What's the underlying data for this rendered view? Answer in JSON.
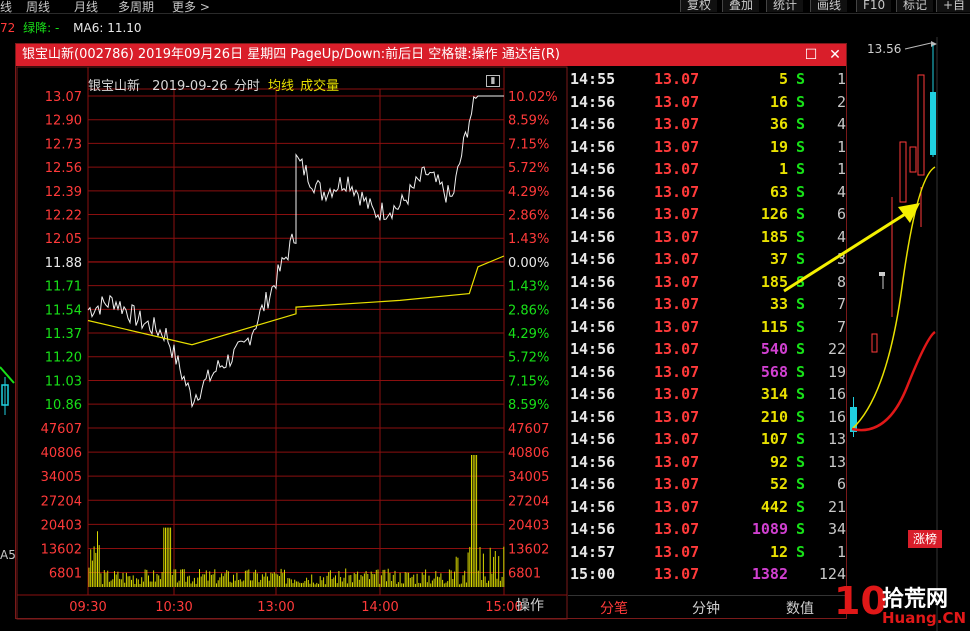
{
  "topbar": {
    "left_items": [
      "线",
      "周线",
      "月线",
      "多周期",
      "更多 >"
    ],
    "right_items": [
      "复权",
      "叠加",
      "统计",
      "画线",
      "F10",
      "标记",
      "+自"
    ]
  },
  "ma_row": {
    "prefix": "72",
    "label": "绿降: -",
    "ma6": "MA6: 11.10"
  },
  "popup": {
    "title": "银宝山新(002786) 2019年09月26日 星期四 PageUp/Down:前后日 空格键:操作 通达信(R)",
    "restore_icon": "restore-icon",
    "close_icon": "close-icon",
    "chart_header": {
      "name": "银宝山新",
      "date": "2019-09-26",
      "mode": "分时",
      "avg_label": "均线",
      "vol_label": "成交量"
    },
    "price_ticks": [
      "13.07",
      "12.90",
      "12.73",
      "12.56",
      "12.39",
      "12.22",
      "12.05",
      "11.88",
      "11.71",
      "11.54",
      "11.37",
      "11.20",
      "11.03",
      "10.86"
    ],
    "pct_ticks": [
      "10.02%",
      "8.59%",
      "7.15%",
      "5.72%",
      "4.29%",
      "2.86%",
      "1.43%",
      "0.00%",
      "1.43%",
      "2.86%",
      "4.29%",
      "5.72%",
      "7.15%",
      "8.59%"
    ],
    "vol_ticks": [
      "47607",
      "40806",
      "34005",
      "27204",
      "20403",
      "13602",
      "6801"
    ],
    "time_ticks": [
      "09:30",
      "10:30",
      "13:00",
      "14:00",
      "15:00"
    ],
    "operate_label": "操作",
    "tabs": [
      "分笔",
      "分钟",
      "数值"
    ],
    "colors": {
      "up": "#ff3a3a",
      "down": "#18e018",
      "neutral": "#e8e8e8",
      "grid": "#8a0f0f",
      "avg": "#e8e000",
      "volume": "#d8d800",
      "big_vol": "#e040e0"
    }
  },
  "trades": [
    {
      "time": "14:55",
      "price": "13.07",
      "vol": "5",
      "side": "S",
      "cnt": "1",
      "vc": "#e8e000"
    },
    {
      "time": "14:56",
      "price": "13.07",
      "vol": "16",
      "side": "S",
      "cnt": "2",
      "vc": "#e8e000"
    },
    {
      "time": "14:56",
      "price": "13.07",
      "vol": "36",
      "side": "S",
      "cnt": "4",
      "vc": "#e8e000"
    },
    {
      "time": "14:56",
      "price": "13.07",
      "vol": "19",
      "side": "S",
      "cnt": "1",
      "vc": "#e8e000"
    },
    {
      "time": "14:56",
      "price": "13.07",
      "vol": "1",
      "side": "S",
      "cnt": "1",
      "vc": "#e8e000"
    },
    {
      "time": "14:56",
      "price": "13.07",
      "vol": "63",
      "side": "S",
      "cnt": "4",
      "vc": "#e8e000"
    },
    {
      "time": "14:56",
      "price": "13.07",
      "vol": "126",
      "side": "S",
      "cnt": "6",
      "vc": "#e8e000"
    },
    {
      "time": "14:56",
      "price": "13.07",
      "vol": "185",
      "side": "S",
      "cnt": "4",
      "vc": "#e8e000"
    },
    {
      "time": "14:56",
      "price": "13.07",
      "vol": "37",
      "side": "S",
      "cnt": "3",
      "vc": "#e8e000"
    },
    {
      "time": "14:56",
      "price": "13.07",
      "vol": "185",
      "side": "S",
      "cnt": "8",
      "vc": "#e8e000"
    },
    {
      "time": "14:56",
      "price": "13.07",
      "vol": "33",
      "side": "S",
      "cnt": "7",
      "vc": "#e8e000"
    },
    {
      "time": "14:56",
      "price": "13.07",
      "vol": "115",
      "side": "S",
      "cnt": "7",
      "vc": "#e8e000"
    },
    {
      "time": "14:56",
      "price": "13.07",
      "vol": "540",
      "side": "S",
      "cnt": "22",
      "vc": "#d040d0"
    },
    {
      "time": "14:56",
      "price": "13.07",
      "vol": "568",
      "side": "S",
      "cnt": "19",
      "vc": "#d040d0"
    },
    {
      "time": "14:56",
      "price": "13.07",
      "vol": "314",
      "side": "S",
      "cnt": "16",
      "vc": "#e8e000"
    },
    {
      "time": "14:56",
      "price": "13.07",
      "vol": "210",
      "side": "S",
      "cnt": "16",
      "vc": "#e8e000"
    },
    {
      "time": "14:56",
      "price": "13.07",
      "vol": "107",
      "side": "S",
      "cnt": "13",
      "vc": "#e8e000"
    },
    {
      "time": "14:56",
      "price": "13.07",
      "vol": "92",
      "side": "S",
      "cnt": "13",
      "vc": "#e8e000"
    },
    {
      "time": "14:56",
      "price": "13.07",
      "vol": "52",
      "side": "S",
      "cnt": "6",
      "vc": "#e8e000"
    },
    {
      "time": "14:56",
      "price": "13.07",
      "vol": "442",
      "side": "S",
      "cnt": "21",
      "vc": "#e8e000"
    },
    {
      "time": "14:56",
      "price": "13.07",
      "vol": "1089",
      "side": "S",
      "cnt": "34",
      "vc": "#d040d0"
    },
    {
      "time": "14:57",
      "price": "13.07",
      "vol": "12",
      "side": "S",
      "cnt": "1",
      "vc": "#e8e000"
    },
    {
      "time": "15:00",
      "price": "13.07",
      "vol": "1382",
      "side": "",
      "cnt": "124",
      "vc": "#d040d0"
    }
  ],
  "right_panel": {
    "high_label": "13.56",
    "badge": "涨榜",
    "left_label": "A5"
  },
  "watermark": {
    "logo_text": "10",
    "brand": "拾荒网",
    "domain": "Huang.CN"
  },
  "chart_data": {
    "type": "line",
    "x_range": [
      "09:30",
      "15:00"
    ],
    "ylim": [
      10.69,
      13.07
    ],
    "prev_close": 11.88,
    "price_series_approx": [
      [
        "09:30",
        11.48
      ],
      [
        "09:45",
        11.55
      ],
      [
        "10:00",
        11.4
      ],
      [
        "10:15",
        11.3
      ],
      [
        "10:30",
        10.82
      ],
      [
        "10:45",
        11.05
      ],
      [
        "11:00",
        11.2
      ],
      [
        "11:15",
        11.6
      ],
      [
        "11:30",
        12.05
      ],
      [
        "13:00",
        12.6
      ],
      [
        "13:15",
        12.35
      ],
      [
        "13:30",
        12.45
      ],
      [
        "13:45",
        12.2
      ],
      [
        "14:00",
        12.25
      ],
      [
        "14:15",
        12.5
      ],
      [
        "14:30",
        12.3
      ],
      [
        "14:40",
        12.9
      ],
      [
        "14:45",
        13.07
      ],
      [
        "15:00",
        13.07
      ]
    ],
    "avg_series_approx": [
      [
        "09:30",
        11.4
      ],
      [
        "10:30",
        11.22
      ],
      [
        "11:30",
        11.45
      ],
      [
        "13:00",
        11.5
      ],
      [
        "14:00",
        11.55
      ],
      [
        "14:40",
        11.6
      ],
      [
        "14:45",
        11.8
      ],
      [
        "15:00",
        11.88
      ]
    ],
    "volume_max": 47607
  }
}
